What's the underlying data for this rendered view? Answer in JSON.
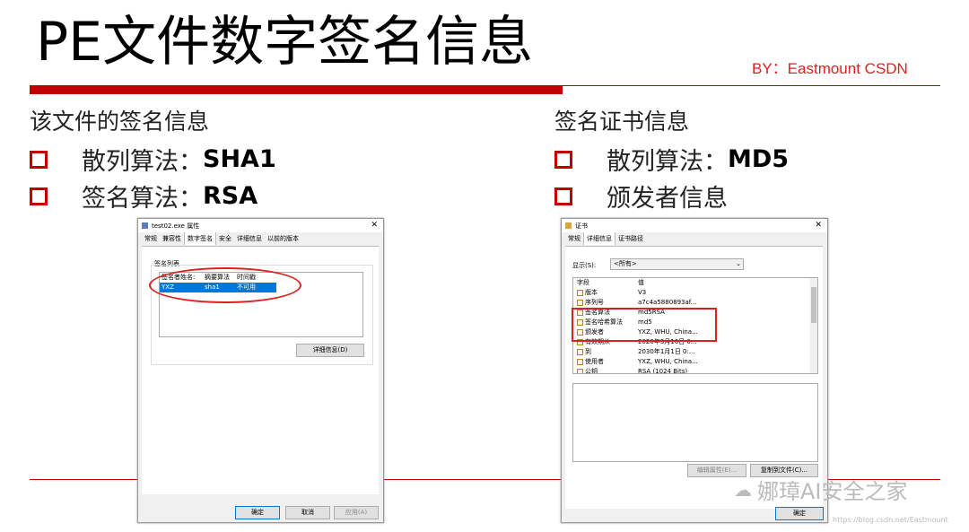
{
  "slide": {
    "title": "PE文件数字签名信息",
    "byline": "BY：Eastmount CSDN",
    "left_heading": "该文件的签名信息",
    "left_bullets": [
      {
        "label": "散列算法：",
        "value": "SHA1"
      },
      {
        "label": "签名算法：",
        "value": "RSA"
      }
    ],
    "right_heading": "签名证书信息",
    "right_bullets": [
      {
        "label": "散列算法：",
        "value": "MD5"
      },
      {
        "label": "颁发者信息",
        "value": ""
      }
    ]
  },
  "props_dialog": {
    "title": "test02.exe 属性",
    "tabs": [
      "常规",
      "兼容性",
      "数字签名",
      "安全",
      "详细信息",
      "以前的版本"
    ],
    "active_tab": "数字签名",
    "group_label": "签名列表",
    "columns": [
      "签名者姓名:",
      "摘要算法",
      "时间戳"
    ],
    "rows": [
      [
        "YXZ",
        "sha1",
        "不可用"
      ]
    ],
    "details_button": "详细信息(D)",
    "ok": "确定",
    "cancel": "取消",
    "apply": "应用(A)"
  },
  "cert_dialog": {
    "title": "证书",
    "tabs": [
      "常规",
      "详细信息",
      "证书路径"
    ],
    "active_tab": "详细信息",
    "show_label": "显示(S):",
    "show_value": "<所有>",
    "columns": [
      "字段",
      "值"
    ],
    "rows": [
      [
        "版本",
        "V3"
      ],
      [
        "序列号",
        "a7c4a5880893af..."
      ],
      [
        "签名算法",
        "md5RSA"
      ],
      [
        "签名哈希算法",
        "md5"
      ],
      [
        "颁发者",
        "YXZ, WHU, China..."
      ],
      [
        "有效期从",
        "2020年3月16日 0..."
      ],
      [
        "到",
        "2030年1月1日 0:..."
      ],
      [
        "使用者",
        "YXZ, WHU, China..."
      ],
      [
        "公钥",
        "RSA (1024 Bits)"
      ]
    ],
    "edit_button": "编辑属性(E)...",
    "copy_button": "复制到文件(C)...",
    "ok": "确定"
  },
  "watermark": {
    "text": "娜璋AI安全之家",
    "url": "https://blog.csdn.net/Eastmount"
  }
}
